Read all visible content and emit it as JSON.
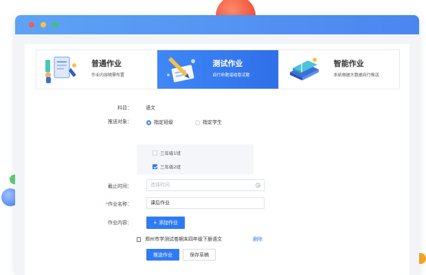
{
  "modes": [
    {
      "title": "普通作业",
      "desc": "作业内容随需布置",
      "active": false,
      "icon": "worksheet-illustration"
    },
    {
      "title": "测试作业",
      "desc": "自行命题或组卷试题",
      "active": true,
      "icon": "pen-paper-illustration"
    },
    {
      "title": "智能作业",
      "desc": "系统根据大数据自行推送",
      "active": false,
      "icon": "books-illustration"
    }
  ],
  "form": {
    "subject": {
      "label": "科目：",
      "value": "语文"
    },
    "target": {
      "label": "推送对象：",
      "options": [
        {
          "label": "指定班级",
          "selected": true
        },
        {
          "label": "指定学生",
          "selected": false
        }
      ],
      "classes": [
        {
          "label": "三年级1班",
          "checked": false
        },
        {
          "label": "三年级2班",
          "checked": true
        }
      ]
    },
    "deadline": {
      "label": "截止时间：",
      "placeholder": "选择时间"
    },
    "name": {
      "required_mark": "*",
      "label": "作业名称：",
      "value": "课后作业"
    },
    "content": {
      "label": "作业内容：",
      "add_button": "+ 添加作业",
      "file_name": "郑州市学测试卷期末四年级下册语文",
      "delete_label": "删除"
    },
    "submit_button": "推送作业",
    "draft_button": "保存草稿"
  },
  "colors": {
    "accent": "#2f7bf5",
    "titlebar": "#4a86ef"
  }
}
